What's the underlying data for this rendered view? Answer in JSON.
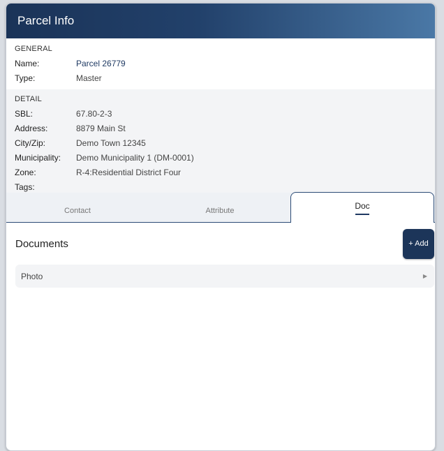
{
  "header": {
    "title": "Parcel Info"
  },
  "general": {
    "section_title": "GENERAL",
    "rows": [
      {
        "label": "Name:",
        "value": "Parcel 26779"
      },
      {
        "label": "Type:",
        "value": "Master"
      }
    ]
  },
  "detail": {
    "section_title": "DETAIL",
    "rows": [
      {
        "label": "SBL:",
        "value": "67.80-2-3"
      },
      {
        "label": "Address:",
        "value": "8879 Main St"
      },
      {
        "label": "City/Zip:",
        "value": "Demo Town 12345"
      },
      {
        "label": "Municipality:",
        "value": "Demo Municipality 1 (DM-0001)"
      },
      {
        "label": "Zone:",
        "value": "R-4:Residential District Four"
      },
      {
        "label": "Tags:",
        "value": ""
      }
    ]
  },
  "tabs": [
    {
      "label": "Contact"
    },
    {
      "label": "Attribute"
    },
    {
      "label": "Doc"
    }
  ],
  "documents": {
    "title": "Documents",
    "add_label": "+ Add",
    "items": [
      {
        "label": "Photo",
        "icon": "triangle-right-icon"
      }
    ]
  }
}
